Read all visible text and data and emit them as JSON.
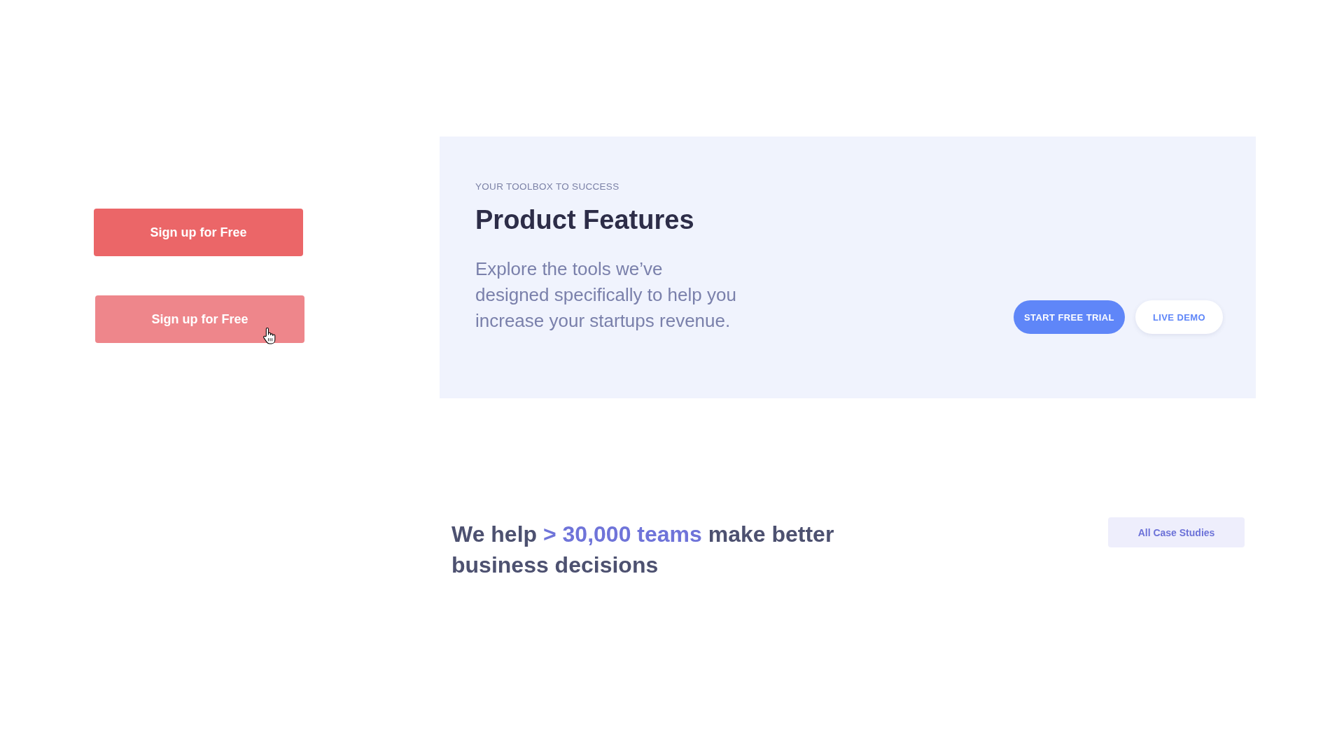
{
  "signup_buttons": [
    {
      "label": "Sign up for Free",
      "hovered": false
    },
    {
      "label": "Sign up for Free",
      "hovered": true
    }
  ],
  "feature_panel": {
    "eyebrow": "YOUR TOOLBOX TO SUCCESS",
    "title": "Product Features",
    "description": "Explore the tools we’ve designed specifically to help you increase your startups revenue.",
    "buttons": [
      {
        "label": "START FREE TRIAL",
        "kind": "primary"
      },
      {
        "label": "LIVE DEMO",
        "kind": "secondary"
      }
    ]
  },
  "stats_section": {
    "headline": [
      {
        "text": "We help",
        "highlight": false
      },
      {
        "text": "> 30,000 teams",
        "highlight": true
      },
      {
        "text": "make better business decisions",
        "highlight": false
      }
    ],
    "button": {
      "label": "All Case Studies"
    }
  }
}
